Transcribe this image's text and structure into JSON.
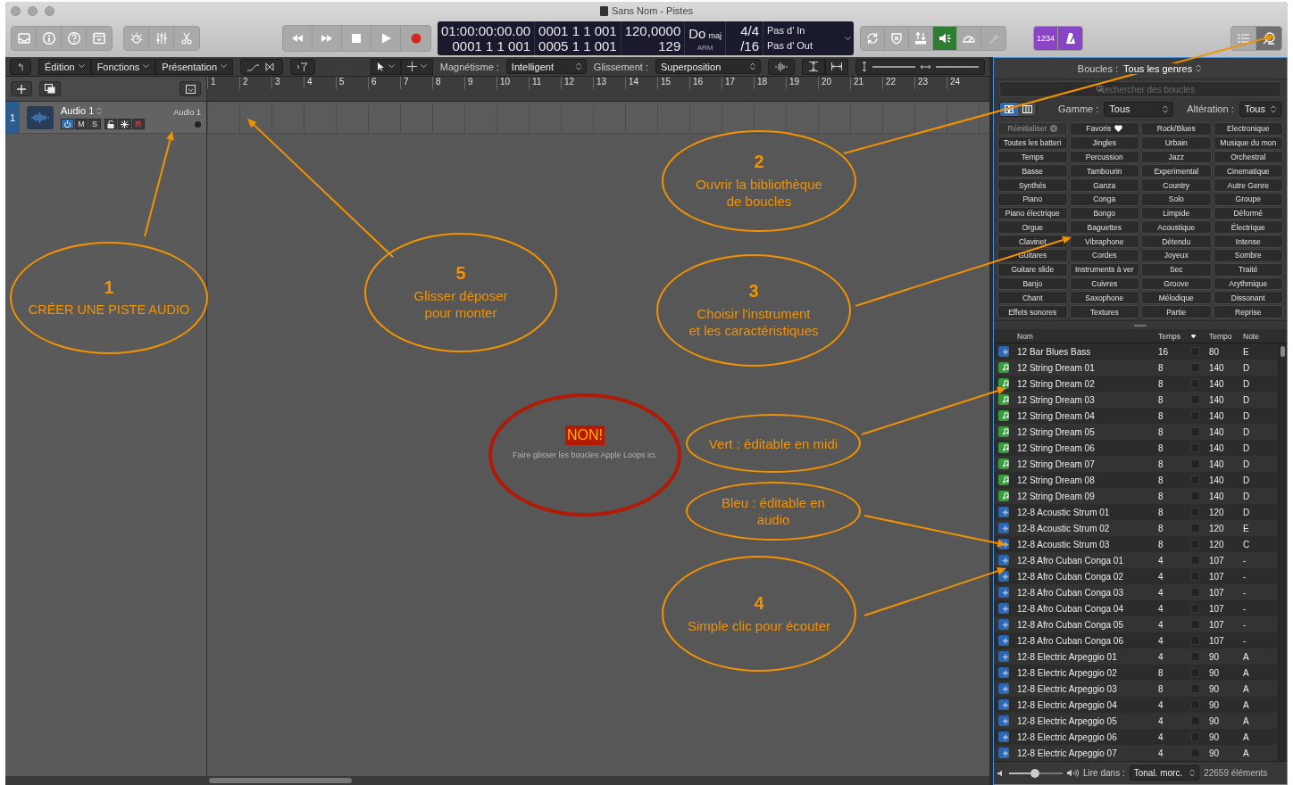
{
  "window": {
    "title": "Sans Nom - Pistes"
  },
  "toolbar": {
    "left_buttons": [
      {
        "kind": "library"
      },
      {
        "kind": "info"
      },
      {
        "kind": "help"
      },
      {
        "kind": "window"
      }
    ],
    "tool_buttons": [
      {
        "kind": "knob"
      },
      {
        "kind": "mixer"
      },
      {
        "kind": "scissors"
      }
    ],
    "transport": [
      {
        "kind": "rewind"
      },
      {
        "kind": "forward"
      },
      {
        "kind": "stop"
      },
      {
        "kind": "play"
      },
      {
        "kind": "record"
      }
    ],
    "lcd": {
      "time": "01:00:00:00.00",
      "time_bars": "0001  1  1  001",
      "start": "0001  1  1  001",
      "end": "0005  1  1  001",
      "tempo": "120,0000",
      "tempo_secondary": "129",
      "key": "Do",
      "mode": "maj",
      "key_label": "ARM",
      "signature": "4/4",
      "division": "/16",
      "marker_in": "Pas d' In",
      "marker_out": "Pas d' Out"
    },
    "mode_buttons": [
      {
        "kind": "cycle",
        "on": false
      },
      {
        "kind": "replace",
        "on": false
      },
      {
        "kind": "bounce",
        "on": false
      },
      {
        "kind": "speaker",
        "on": true
      },
      {
        "kind": "gauge",
        "on": false
      },
      {
        "kind": "tuner",
        "on": false
      }
    ],
    "count_in": {
      "label": "1234",
      "on": true
    },
    "metronome": {
      "on": true
    },
    "view_buttons": [
      {
        "kind": "list",
        "on": false
      },
      {
        "kind": "loops",
        "on": true
      }
    ]
  },
  "edit_bar": {
    "menus": [
      "Édition",
      "Fonctions",
      "Présentation"
    ],
    "snap_label": "Magnétisme :",
    "snap_value": "Intelligent",
    "drag_label": "Glissement :",
    "drag_value": "Superposition"
  },
  "ruler": {
    "bars": [
      "1",
      "2",
      "3",
      "4",
      "5",
      "6",
      "7",
      "8",
      "9",
      "10",
      "11",
      "12",
      "13",
      "14",
      "15",
      "16",
      "17",
      "18",
      "19",
      "20",
      "21",
      "22",
      "23",
      "24"
    ]
  },
  "track": {
    "number": "1",
    "name": "Audio 1",
    "channel": "Audio 1",
    "on": true,
    "mute": "M",
    "solo": "S",
    "record": "R"
  },
  "annotations": [
    {
      "kind": "step",
      "number": "1",
      "lines": [
        "CRÉER UNE PISTE AUDIO"
      ]
    },
    {
      "kind": "step",
      "number": "5",
      "lines": [
        "Glisser déposer",
        "pour monter"
      ]
    },
    {
      "kind": "step",
      "number": "2",
      "lines": [
        "Ouvrir la bibliothèque",
        "de boucles"
      ]
    },
    {
      "kind": "step",
      "number": "3",
      "lines": [
        "Choisir l'instrument",
        "et les caractéristiques"
      ]
    },
    {
      "kind": "warning",
      "badge": "NON!",
      "lines": [
        "Faire glisser les boucles Apple Loops ici."
      ]
    },
    {
      "kind": "note",
      "lines": [
        "Vert : éditable en midi"
      ]
    },
    {
      "kind": "note",
      "lines": [
        "Bleu : éditable en",
        "audio"
      ]
    },
    {
      "kind": "step",
      "number": "4",
      "lines": [
        "Simple clic pour écouter"
      ]
    }
  ],
  "browser": {
    "title_label": "Boucles :",
    "title_value": "Tous les genres",
    "search": {
      "placeholder": "Rechercher des boucles"
    },
    "view_modes": [
      {
        "kind": "buttons",
        "selected": true
      },
      {
        "kind": "columns",
        "selected": false
      }
    ],
    "scale_label": "Gamme :",
    "scale_value": "Tous",
    "signature_label": "Altération :",
    "signature_value": "Tous",
    "reset_button": {
      "label": "Réinitialiser",
      "disabled": true
    },
    "favorites_button": {
      "label": "Favoris"
    },
    "keywords": [
      "Rock/Blues",
      "Electronique",
      "Toutes les batteri",
      "Jingles",
      "Urbain",
      "Musique du mon",
      "Temps",
      "Percussion",
      "Jazz",
      "Orchestral",
      "Basse",
      "Tambourin",
      "Experimental",
      "Cinematique",
      "Synthés",
      "Ganza",
      "Country",
      "Autre Genre",
      "Piano",
      "Conga",
      "Solo",
      "Groupe",
      "Piano électrique",
      "Bongo",
      "Limpide",
      "Déformé",
      "Orgue",
      "Baguettes",
      "Acoustique",
      "Électrique",
      "Clavinet",
      "Vibraphone",
      "Détendu",
      "Intense",
      "Guitares",
      "Cordes",
      "Joyeux",
      "Sombre",
      "Guitare slide",
      "Instruments à ver",
      "Sec",
      "Traité",
      "Banjo",
      "Cuivres",
      "Groove",
      "Arythmique",
      "Chant",
      "Saxophone",
      "Mélodique",
      "Dissonant",
      "Effets sonores",
      "Textures",
      "Partie",
      "Reprise"
    ],
    "columns": [
      "Nom",
      "Temps",
      "Tempo",
      "Note"
    ],
    "loops": [
      {
        "kind": "audio",
        "name": "12 Bar Blues Bass",
        "beats": "16",
        "favorite": false,
        "tempo": "80",
        "note": "E"
      },
      {
        "kind": "midi",
        "name": "12 String Dream 01",
        "beats": "8",
        "favorite": false,
        "tempo": "140",
        "note": "D"
      },
      {
        "kind": "midi",
        "name": "12 String Dream 02",
        "beats": "8",
        "favorite": false,
        "tempo": "140",
        "note": "D"
      },
      {
        "kind": "midi",
        "name": "12 String Dream 03",
        "beats": "8",
        "favorite": false,
        "tempo": "140",
        "note": "D"
      },
      {
        "kind": "midi",
        "name": "12 String Dream 04",
        "beats": "8",
        "favorite": false,
        "tempo": "140",
        "note": "D"
      },
      {
        "kind": "midi",
        "name": "12 String Dream 05",
        "beats": "8",
        "favorite": false,
        "tempo": "140",
        "note": "D"
      },
      {
        "kind": "midi",
        "name": "12 String Dream 06",
        "beats": "8",
        "favorite": false,
        "tempo": "140",
        "note": "D"
      },
      {
        "kind": "midi",
        "name": "12 String Dream 07",
        "beats": "8",
        "favorite": false,
        "tempo": "140",
        "note": "D"
      },
      {
        "kind": "midi",
        "name": "12 String Dream 08",
        "beats": "8",
        "favorite": false,
        "tempo": "140",
        "note": "D"
      },
      {
        "kind": "midi",
        "name": "12 String Dream 09",
        "beats": "8",
        "favorite": false,
        "tempo": "140",
        "note": "D"
      },
      {
        "kind": "audio",
        "name": "12-8 Acoustic Strum 01",
        "beats": "8",
        "favorite": false,
        "tempo": "120",
        "note": "D"
      },
      {
        "kind": "audio",
        "name": "12-8 Acoustic Strum 02",
        "beats": "8",
        "favorite": false,
        "tempo": "120",
        "note": "E"
      },
      {
        "kind": "audio",
        "name": "12-8 Acoustic Strum 03",
        "beats": "8",
        "favorite": false,
        "tempo": "120",
        "note": "C"
      },
      {
        "kind": "audio",
        "name": "12-8 Afro Cuban Conga 01",
        "beats": "4",
        "favorite": false,
        "tempo": "107",
        "note": "-"
      },
      {
        "kind": "audio",
        "name": "12-8 Afro Cuban Conga 02",
        "beats": "4",
        "favorite": false,
        "tempo": "107",
        "note": "-"
      },
      {
        "kind": "audio",
        "name": "12-8 Afro Cuban Conga 03",
        "beats": "4",
        "favorite": false,
        "tempo": "107",
        "note": "-"
      },
      {
        "kind": "audio",
        "name": "12-8 Afro Cuban Conga 04",
        "beats": "4",
        "favorite": false,
        "tempo": "107",
        "note": "-"
      },
      {
        "kind": "audio",
        "name": "12-8 Afro Cuban Conga 05",
        "beats": "4",
        "favorite": false,
        "tempo": "107",
        "note": "-"
      },
      {
        "kind": "audio",
        "name": "12-8 Afro Cuban Conga 06",
        "beats": "4",
        "favorite": false,
        "tempo": "107",
        "note": "-"
      },
      {
        "kind": "audio",
        "name": "12-8 Electric Arpeggio 01",
        "beats": "4",
        "favorite": false,
        "tempo": "90",
        "note": "A"
      },
      {
        "kind": "audio",
        "name": "12-8 Electric Arpeggio 02",
        "beats": "8",
        "favorite": false,
        "tempo": "90",
        "note": "A"
      },
      {
        "kind": "audio",
        "name": "12-8 Electric Arpeggio 03",
        "beats": "8",
        "favorite": false,
        "tempo": "90",
        "note": "A"
      },
      {
        "kind": "audio",
        "name": "12-8 Electric Arpeggio 04",
        "beats": "4",
        "favorite": false,
        "tempo": "90",
        "note": "A"
      },
      {
        "kind": "audio",
        "name": "12-8 Electric Arpeggio 05",
        "beats": "4",
        "favorite": false,
        "tempo": "90",
        "note": "A"
      },
      {
        "kind": "audio",
        "name": "12-8 Electric Arpeggio 06",
        "beats": "4",
        "favorite": false,
        "tempo": "90",
        "note": "A"
      },
      {
        "kind": "audio",
        "name": "12-8 Electric Arpeggio 07",
        "beats": "4",
        "favorite": false,
        "tempo": "90",
        "note": "A"
      }
    ],
    "footer": {
      "volume": {
        "level": 0.48
      },
      "play_label": "Lire dans :",
      "play_value": "Tonal. morc.",
      "count": "22659 éléments"
    }
  }
}
